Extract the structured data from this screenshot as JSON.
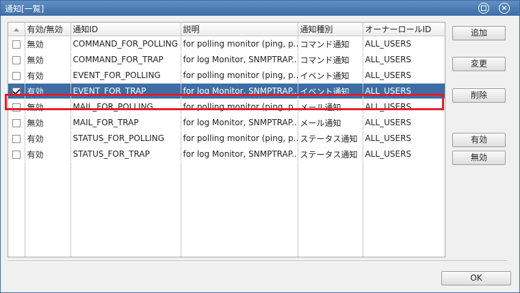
{
  "window": {
    "title": "通知[一覧]"
  },
  "table": {
    "columns": [
      "有効/無効",
      "通知ID",
      "説明",
      "通知種別",
      "オーナーロールID"
    ],
    "rows": [
      {
        "checked": false,
        "status": "無効",
        "id": "COMMAND_FOR_POLLING",
        "description": "for polling monitor (ping, p...",
        "type": "コマンド通知",
        "owner": "ALL_USERS"
      },
      {
        "checked": false,
        "status": "無効",
        "id": "COMMAND_FOR_TRAP",
        "description": "for log Monitor, SNMPTRAP...",
        "type": "コマンド通知",
        "owner": "ALL_USERS"
      },
      {
        "checked": false,
        "status": "有効",
        "id": "EVENT_FOR_POLLING",
        "description": "for polling monitor (ping, p...",
        "type": "イベント通知",
        "owner": "ALL_USERS"
      },
      {
        "checked": true,
        "status": "有効",
        "id": "EVENT_FOR_TRAP",
        "description": "for log Monitor, SNMPTRAP...",
        "type": "イベント通知",
        "owner": "ALL_USERS"
      },
      {
        "checked": false,
        "status": "無効",
        "id": "MAIL_FOR_POLLING",
        "description": "for polling monitor (ping, p...",
        "type": "メール通知",
        "owner": "ALL_USERS"
      },
      {
        "checked": false,
        "status": "無効",
        "id": "MAIL_FOR_TRAP",
        "description": "for log Monitor, SNMPTRAP...",
        "type": "メール通知",
        "owner": "ALL_USERS"
      },
      {
        "checked": false,
        "status": "有効",
        "id": "STATUS_FOR_POLLING",
        "description": "for polling monitor (ping, p...",
        "type": "ステータス通知",
        "owner": "ALL_USERS"
      },
      {
        "checked": false,
        "status": "有効",
        "id": "STATUS_FOR_TRAP",
        "description": "for log Monitor, SNMPTRAP...",
        "type": "ステータス通知",
        "owner": "ALL_USERS"
      }
    ]
  },
  "buttons": {
    "add": "追加",
    "modify": "変更",
    "delete": "削除",
    "enable": "有効",
    "disable": "無効",
    "ok": "OK"
  },
  "colors": {
    "selected_row": "#3c6ea5",
    "highlight_border": "#e01e2b",
    "titlebar": "#4a7bb4"
  },
  "icons": {
    "restore": "restore-icon",
    "close": "close-icon",
    "sort": "sort-ascending-icon"
  }
}
